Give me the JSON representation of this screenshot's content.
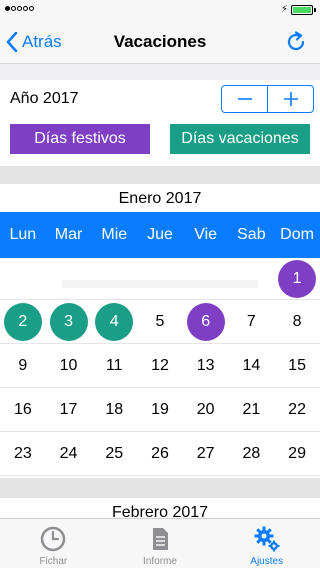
{
  "nav": {
    "back_label": "Atrás",
    "title": "Vacaciones"
  },
  "year": {
    "label": "Año 2017"
  },
  "buttons": {
    "festivos": "Días festivos",
    "vacaciones": "Días vacaciones"
  },
  "colors": {
    "accent": "#0a7cff",
    "festivo": "#7e3fc5",
    "vacacion": "#1a9e87"
  },
  "calendar": {
    "month_title": "Enero 2017",
    "weekdays": [
      "Lun",
      "Mar",
      "Mie",
      "Jue",
      "Vie",
      "Sab",
      "Dom"
    ],
    "weeks": [
      [
        {
          "day": "",
          "mark": ""
        },
        {
          "day": "",
          "mark": ""
        },
        {
          "day": "",
          "mark": ""
        },
        {
          "day": "",
          "mark": ""
        },
        {
          "day": "",
          "mark": ""
        },
        {
          "day": "",
          "mark": ""
        },
        {
          "day": "1",
          "mark": "festivo"
        }
      ],
      [
        {
          "day": "2",
          "mark": "vacacion"
        },
        {
          "day": "3",
          "mark": "vacacion"
        },
        {
          "day": "4",
          "mark": "vacacion"
        },
        {
          "day": "5",
          "mark": ""
        },
        {
          "day": "6",
          "mark": "festivo"
        },
        {
          "day": "7",
          "mark": ""
        },
        {
          "day": "8",
          "mark": ""
        }
      ],
      [
        {
          "day": "9",
          "mark": ""
        },
        {
          "day": "10",
          "mark": ""
        },
        {
          "day": "11",
          "mark": ""
        },
        {
          "day": "12",
          "mark": ""
        },
        {
          "day": "13",
          "mark": ""
        },
        {
          "day": "14",
          "mark": ""
        },
        {
          "day": "15",
          "mark": ""
        }
      ],
      [
        {
          "day": "16",
          "mark": ""
        },
        {
          "day": "17",
          "mark": ""
        },
        {
          "day": "18",
          "mark": ""
        },
        {
          "day": "19",
          "mark": ""
        },
        {
          "day": "20",
          "mark": ""
        },
        {
          "day": "21",
          "mark": ""
        },
        {
          "day": "22",
          "mark": ""
        }
      ],
      [
        {
          "day": "23",
          "mark": ""
        },
        {
          "day": "24",
          "mark": ""
        },
        {
          "day": "25",
          "mark": ""
        },
        {
          "day": "26",
          "mark": ""
        },
        {
          "day": "27",
          "mark": ""
        },
        {
          "day": "28",
          "mark": ""
        },
        {
          "day": "29",
          "mark": ""
        }
      ]
    ],
    "next_month_title": "Febrero 2017"
  },
  "tabs": [
    {
      "label": "Fichar",
      "icon": "clock-icon",
      "active": false
    },
    {
      "label": "Informe",
      "icon": "document-icon",
      "active": false
    },
    {
      "label": "Ajustes",
      "icon": "gears-icon",
      "active": true
    }
  ]
}
